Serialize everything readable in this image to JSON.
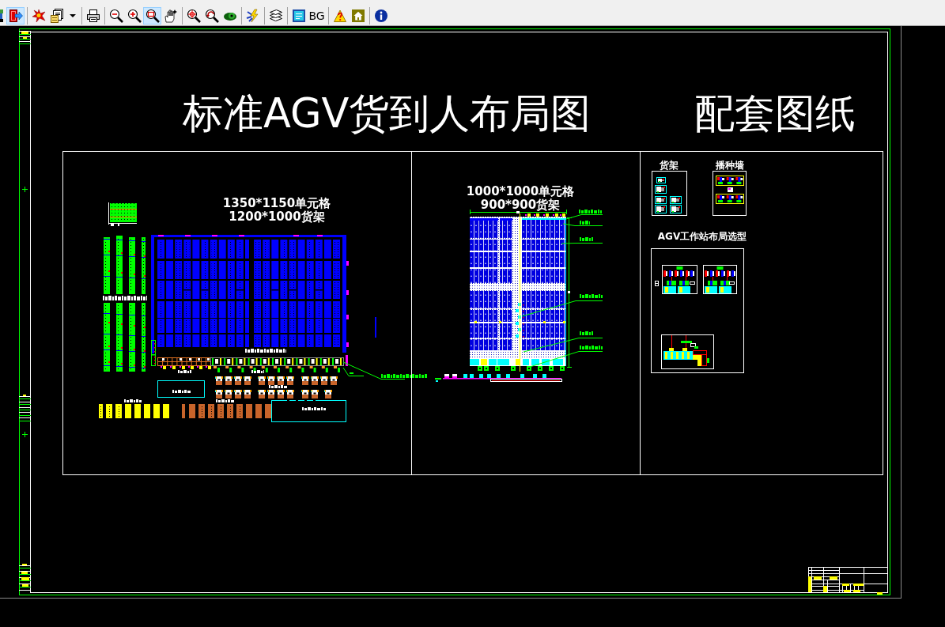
{
  "toolbar": {
    "groups": [
      [
        {
          "kind": "icon",
          "selected": true
        }
      ],
      [
        {
          "kind": "icon",
          "selected": false
        },
        {
          "kind": "icon",
          "selected": false
        },
        {
          "kind": "menu",
          "selected": false
        }
      ],
      [
        {
          "kind": "icon",
          "selected": false
        }
      ],
      [
        {
          "kind": "icon",
          "selected": false
        },
        {
          "kind": "icon",
          "selected": false
        },
        {
          "kind": "icon",
          "selected": true
        },
        {
          "kind": "icon",
          "selected": false
        }
      ],
      [
        {
          "kind": "icon",
          "selected": false
        },
        {
          "kind": "icon",
          "selected": false
        },
        {
          "kind": "icon",
          "selected": false
        }
      ],
      [
        {
          "kind": "icon",
          "selected": false
        }
      ],
      [
        {
          "kind": "icon",
          "selected": false
        }
      ],
      [
        {
          "kind": "icon",
          "selected": false
        },
        {
          "kind": "text",
          "label": "BG",
          "selected": false
        }
      ],
      [
        {
          "kind": "icon",
          "selected": false
        },
        {
          "kind": "icon",
          "selected": false
        }
      ],
      [
        {
          "kind": "icon",
          "selected": false
        }
      ]
    ]
  },
  "drawing": {
    "title": "标准AGV货到人布局图",
    "subtitle": "配套图纸",
    "layouts": [
      {
        "kind": "standard",
        "cell_size": "1350*1150单元格",
        "rack_size": "1200*1000货架"
      },
      {
        "kind": "dense",
        "cell_size": "1000*1000单元格",
        "rack_size": "900*900货架"
      }
    ],
    "details": [
      {
        "kind": "rack",
        "label": "货架"
      },
      {
        "kind": "seeding-wall",
        "label": "播种墙"
      }
    ],
    "workstation_options": {
      "title": "AGV工作站布局选型"
    }
  }
}
